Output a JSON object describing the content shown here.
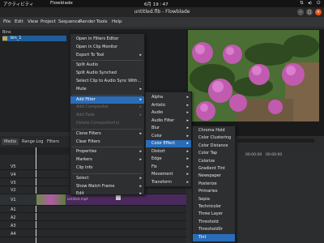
{
  "topbar": {
    "activities": "アクティビティ",
    "app": "Flowblade",
    "clock": "6月 19 ∶ 47"
  },
  "window": {
    "title": "untitled.flb - Flowblade"
  },
  "menubar": {
    "items": [
      "File",
      "Edit",
      "View",
      "Project",
      "Sequence",
      "Render",
      "Tools",
      "Help"
    ]
  },
  "bins": {
    "header": "Bins",
    "selected": "bin_1"
  },
  "timeline": {
    "tabs": [
      "Media",
      "Range Log",
      "Filters"
    ],
    "tracks": [
      "V5",
      "V4",
      "V3",
      "V2",
      "V1",
      "A1",
      "A2",
      "A3",
      "A4"
    ],
    "clip_name": "untitled.mp4"
  },
  "monitor": {
    "tc1": "00:00:00",
    "tc2": "00:00:00"
  },
  "context_menu": {
    "items": [
      {
        "label": "Open in Filters Editor",
        "enabled": true
      },
      {
        "label": "Open in Clip Monitor",
        "enabled": true
      },
      {
        "label": "Export To Tool",
        "enabled": true,
        "sub": true
      },
      {
        "label": "Split Audio",
        "enabled": true
      },
      {
        "label": "Split Audio Synched",
        "enabled": true
      },
      {
        "label": "Select Clip to Audio Sync With...",
        "enabled": true
      },
      {
        "label": "Mute",
        "enabled": true,
        "sub": true
      },
      {
        "label": "Add Filter",
        "enabled": true,
        "sub": true,
        "highlight": true
      },
      {
        "label": "Add Compositor",
        "enabled": false,
        "sub": true
      },
      {
        "label": "Add Fade",
        "enabled": false,
        "sub": true
      },
      {
        "label": "Delete Compositor(s)",
        "enabled": false
      },
      {
        "label": "Clone Filters",
        "enabled": true,
        "sub": true
      },
      {
        "label": "Clear Filters",
        "enabled": true
      },
      {
        "label": "Properties",
        "enabled": true,
        "sub": true
      },
      {
        "label": "Markers",
        "enabled": true,
        "sub": true
      },
      {
        "label": "Clip Info",
        "enabled": true
      },
      {
        "label": "Select",
        "enabled": true,
        "sub": true
      },
      {
        "label": "Show Match Frame",
        "enabled": true,
        "sub": true
      },
      {
        "label": "Edit",
        "enabled": true,
        "sub": true
      }
    ]
  },
  "filter_menu": {
    "items": [
      {
        "label": "Alpha"
      },
      {
        "label": "Artistic"
      },
      {
        "label": "Audio"
      },
      {
        "label": "Audio Filter"
      },
      {
        "label": "Blur"
      },
      {
        "label": "Color"
      },
      {
        "label": "Color Effect",
        "highlight": true
      },
      {
        "label": "Distort"
      },
      {
        "label": "Edge"
      },
      {
        "label": "Fix"
      },
      {
        "label": "Movement"
      },
      {
        "label": "Transform"
      }
    ]
  },
  "effect_menu": {
    "items": [
      {
        "label": "Chroma Hold"
      },
      {
        "label": "Color Clustering"
      },
      {
        "label": "Color Distance"
      },
      {
        "label": "Color Tap"
      },
      {
        "label": "Colorize"
      },
      {
        "label": "Gradient Tint"
      },
      {
        "label": "Newspaper"
      },
      {
        "label": "Posterize"
      },
      {
        "label": "Primaries"
      },
      {
        "label": "Sepia"
      },
      {
        "label": "Technicolor"
      },
      {
        "label": "Three Layer"
      },
      {
        "label": "Threshold"
      },
      {
        "label": "Threshold0r"
      },
      {
        "label": "Tint",
        "highlight": true
      }
    ]
  }
}
